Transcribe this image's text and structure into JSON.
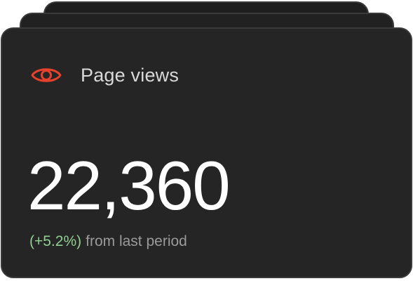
{
  "card": {
    "title": "Page views",
    "icon": "eye-icon",
    "value": "22,360",
    "change": "(+5.2%)",
    "change_suffix": "from last period"
  },
  "colors": {
    "accent": "#e8412c",
    "positive": "#8fcf92",
    "card_bg": "#252525"
  }
}
